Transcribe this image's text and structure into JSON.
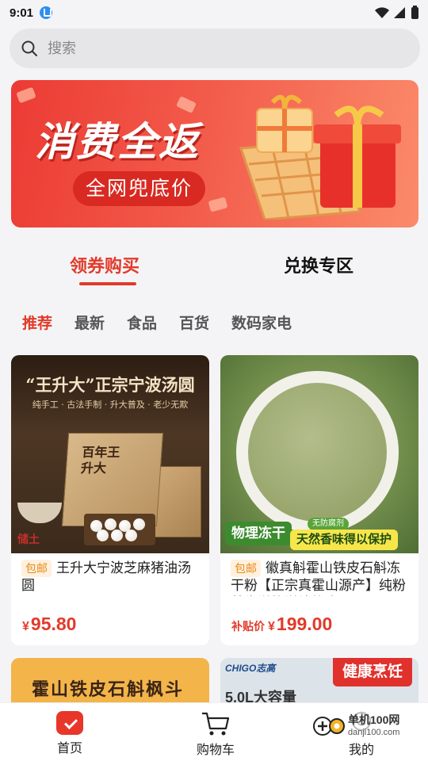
{
  "status": {
    "time": "9:01"
  },
  "search": {
    "placeholder": "搜索"
  },
  "banner": {
    "title": "消费全返",
    "subtitle": "全网兜底价"
  },
  "main_tabs": [
    {
      "label": "领券购买"
    },
    {
      "label": "兑换专区"
    }
  ],
  "categories": [
    {
      "label": "推荐"
    },
    {
      "label": "最新"
    },
    {
      "label": "食品"
    },
    {
      "label": "百货"
    },
    {
      "label": "数码家电"
    }
  ],
  "products": [
    {
      "image_title": "“王升大”正宗宁波汤圆",
      "image_subtitle": "纯手工 · 古法手制 · 升大普及 · 老少无欺",
      "box_label": "百年王升大",
      "stamp": "储土",
      "tag": "包邮",
      "title": "王升大宁波芝麻猪油汤圆",
      "price_prefix": "",
      "currency": "¥",
      "price": "95.80"
    },
    {
      "badge_main": "物理冻干",
      "badge_small": "无防腐剂",
      "badge_slogan": "天然香味得以保护",
      "tag": "包邮",
      "title": "徽真斛霍山铁皮石斛冻干粉【正宗真霍山源产】纯粉养生送礼滋补礼盒",
      "price_prefix": "补贴价",
      "currency": "¥",
      "price": "199.00"
    }
  ],
  "partial_cards": [
    {
      "text": "霍山铁皮石斛枫斗"
    },
    {
      "brand": "CHIGO志高",
      "badge": "健康烹饪",
      "capacity": "5.0L大容量"
    }
  ],
  "bottom_nav": [
    {
      "label": "首页"
    },
    {
      "label": "购物车"
    },
    {
      "label": "我的"
    }
  ],
  "watermark": {
    "text": "单机100网",
    "url": "danji100.com"
  },
  "colors": {
    "accent": "#e23a2a",
    "banner": "#ec3b34",
    "green_badge": "#3c8b2e"
  }
}
